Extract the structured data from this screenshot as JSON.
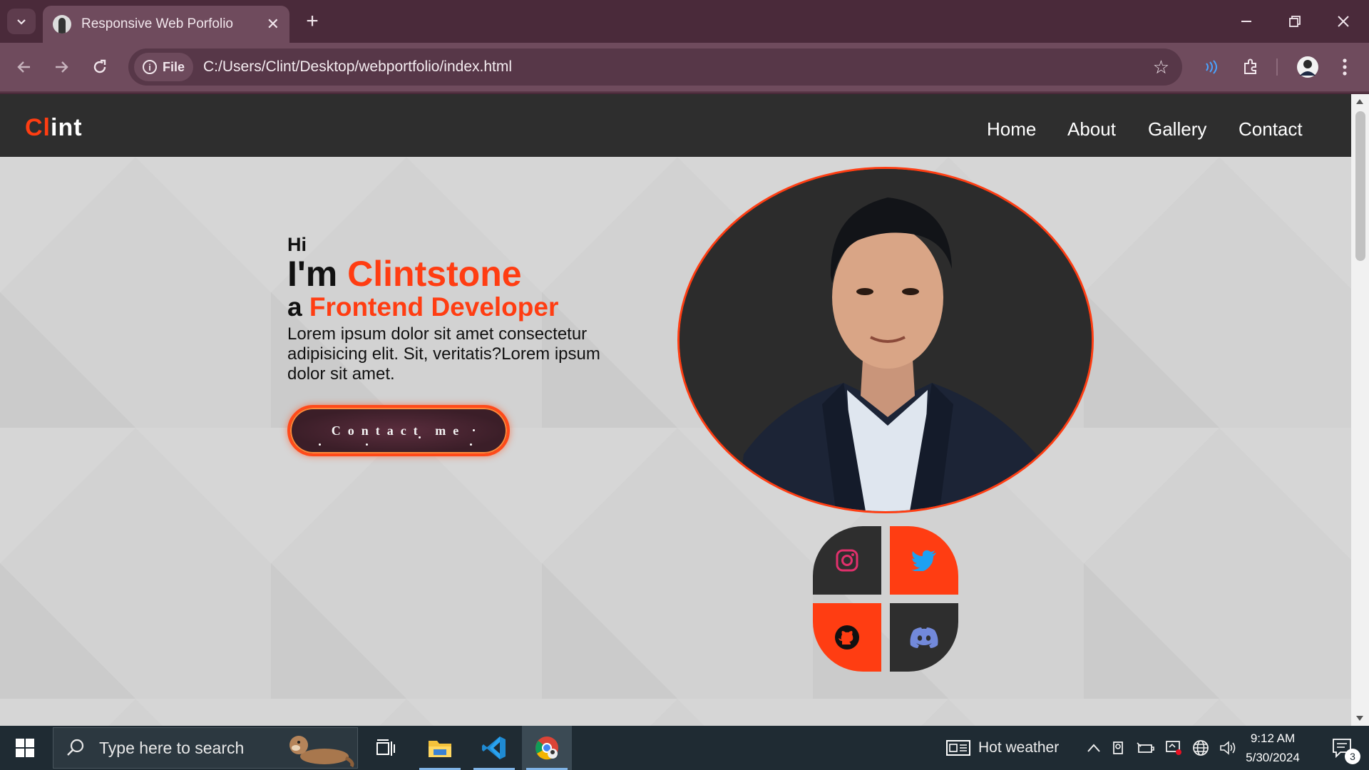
{
  "browser": {
    "tab_title": "Responsive Web Porfolio",
    "new_tab_label": "+",
    "file_chip_label": "File",
    "url": "C:/Users/Clint/Desktop/webportfolio/index.html"
  },
  "site": {
    "logo_accent": "Cl",
    "logo_rest": "int",
    "nav": [
      "Home",
      "About",
      "Gallery",
      "Contact"
    ],
    "hero": {
      "hi": "Hi",
      "im_prefix": "I'm ",
      "name": "Clintstone",
      "role_prefix": "a ",
      "role": "Frontend Developer",
      "blurb": "Lorem ipsum dolor sit amet consectetur adipisicing elit. Sit, veritatis?Lorem ipsum dolor sit amet.",
      "button": "Contact me"
    },
    "socials": [
      "instagram-icon",
      "twitter-icon",
      "github-icon",
      "discord-icon"
    ],
    "colors": {
      "accent": "#ff3d12",
      "nav_bg": "#2e2e2e",
      "page_bg": "#d3d3d3"
    }
  },
  "taskbar": {
    "search_placeholder": "Type here to search",
    "weather": "Hot weather",
    "time": "9:12 AM",
    "date": "5/30/2024",
    "notification_count": "3"
  }
}
